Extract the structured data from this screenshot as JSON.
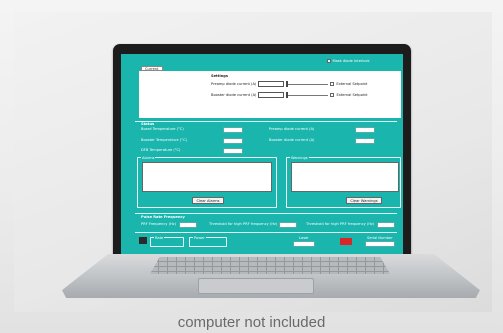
{
  "caption": "computer not included",
  "app": {
    "tab_current": "Current",
    "mask_diode_label": "Mask diode interlock",
    "settings": {
      "title": "Settings",
      "preamp_label": "Preamp diode current (A)",
      "booster_label": "Booster diode current (A)",
      "external_setpoint_1": "External Setpoint",
      "external_setpoint_2": "External Setpoint"
    },
    "status": {
      "title": "Status",
      "board_temp": "Board Temperature (°C)",
      "booster_temp": "Booster Temperature (°C)",
      "dfb_temp": "DFB Temperature (°C)",
      "preamp_current": "Preamp diode current (A)",
      "booster_current": "Booster diode current (A)"
    },
    "alarms": {
      "title": "Alarms",
      "clear_label": "Clear Alarms"
    },
    "warnings": {
      "title": "Warnings",
      "clear_label": "Clear Warnings"
    },
    "pulse": {
      "title": "Pulse Rate Frequency",
      "prf_label": "PRF Frequency (Hz)",
      "thresh_high_label": "Threshold for high PRF frequency (Hz)",
      "thresh_low_label": "Threshold for high PRF frequency (Hz)"
    },
    "bottom": {
      "rate_label": "Rate",
      "power_label": "Power",
      "laser_label": "Laser",
      "serial_label": "Serial Number"
    }
  },
  "colors": {
    "screen_bg": "#1ab5ac",
    "alarm_red": "#d92626"
  }
}
